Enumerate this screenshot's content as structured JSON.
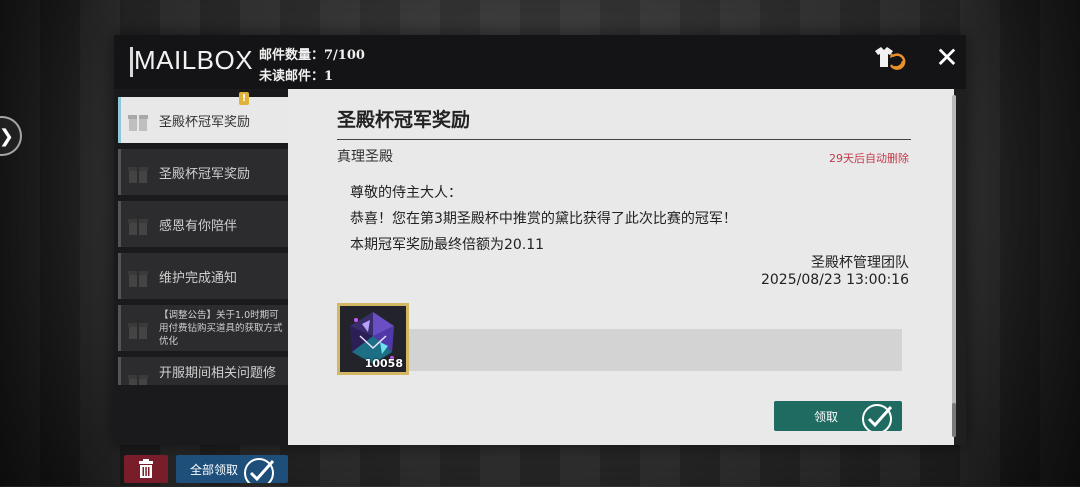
{
  "header": {
    "title": "MAILBOX",
    "mail_count_label": "邮件数量：7/100",
    "unread_label": "未读邮件：1"
  },
  "sidebar": {
    "items": [
      {
        "label": "圣殿杯冠军奖励",
        "active": true,
        "badge": "!"
      },
      {
        "label": "圣殿杯冠军奖励"
      },
      {
        "label": "感恩有你陪伴"
      },
      {
        "label": "维护完成通知"
      },
      {
        "label": "【调整公告】关于1.0时期可用付费钻购买道具的获取方式优化"
      },
      {
        "label": "开服期间相关问题修"
      }
    ],
    "collect_all_label": "全部领取"
  },
  "mail": {
    "title": "圣殿杯冠军奖励",
    "sender": "真理圣殿",
    "expire": "29天后自动删除",
    "greeting": "尊敬的侍主大人：",
    "line1": "恭喜！您在第3期圣殿杯中推赏的黛比获得了此次比赛的冠军！",
    "line2": "本期冠军奖励最终倍额为20.11",
    "signature_name": "圣殿杯管理团队",
    "signature_date": "2025/08/23 13:00:16",
    "reward": {
      "icon": "crystal-item-icon",
      "count": "10058"
    },
    "claim_label": "领取"
  },
  "colors": {
    "accent_red": "#c23a4c",
    "claim_green": "#1f6b62",
    "collect_blue": "#1d4f7a",
    "delete_red": "#7a1d2a",
    "reward_frame": "#d4b763"
  }
}
